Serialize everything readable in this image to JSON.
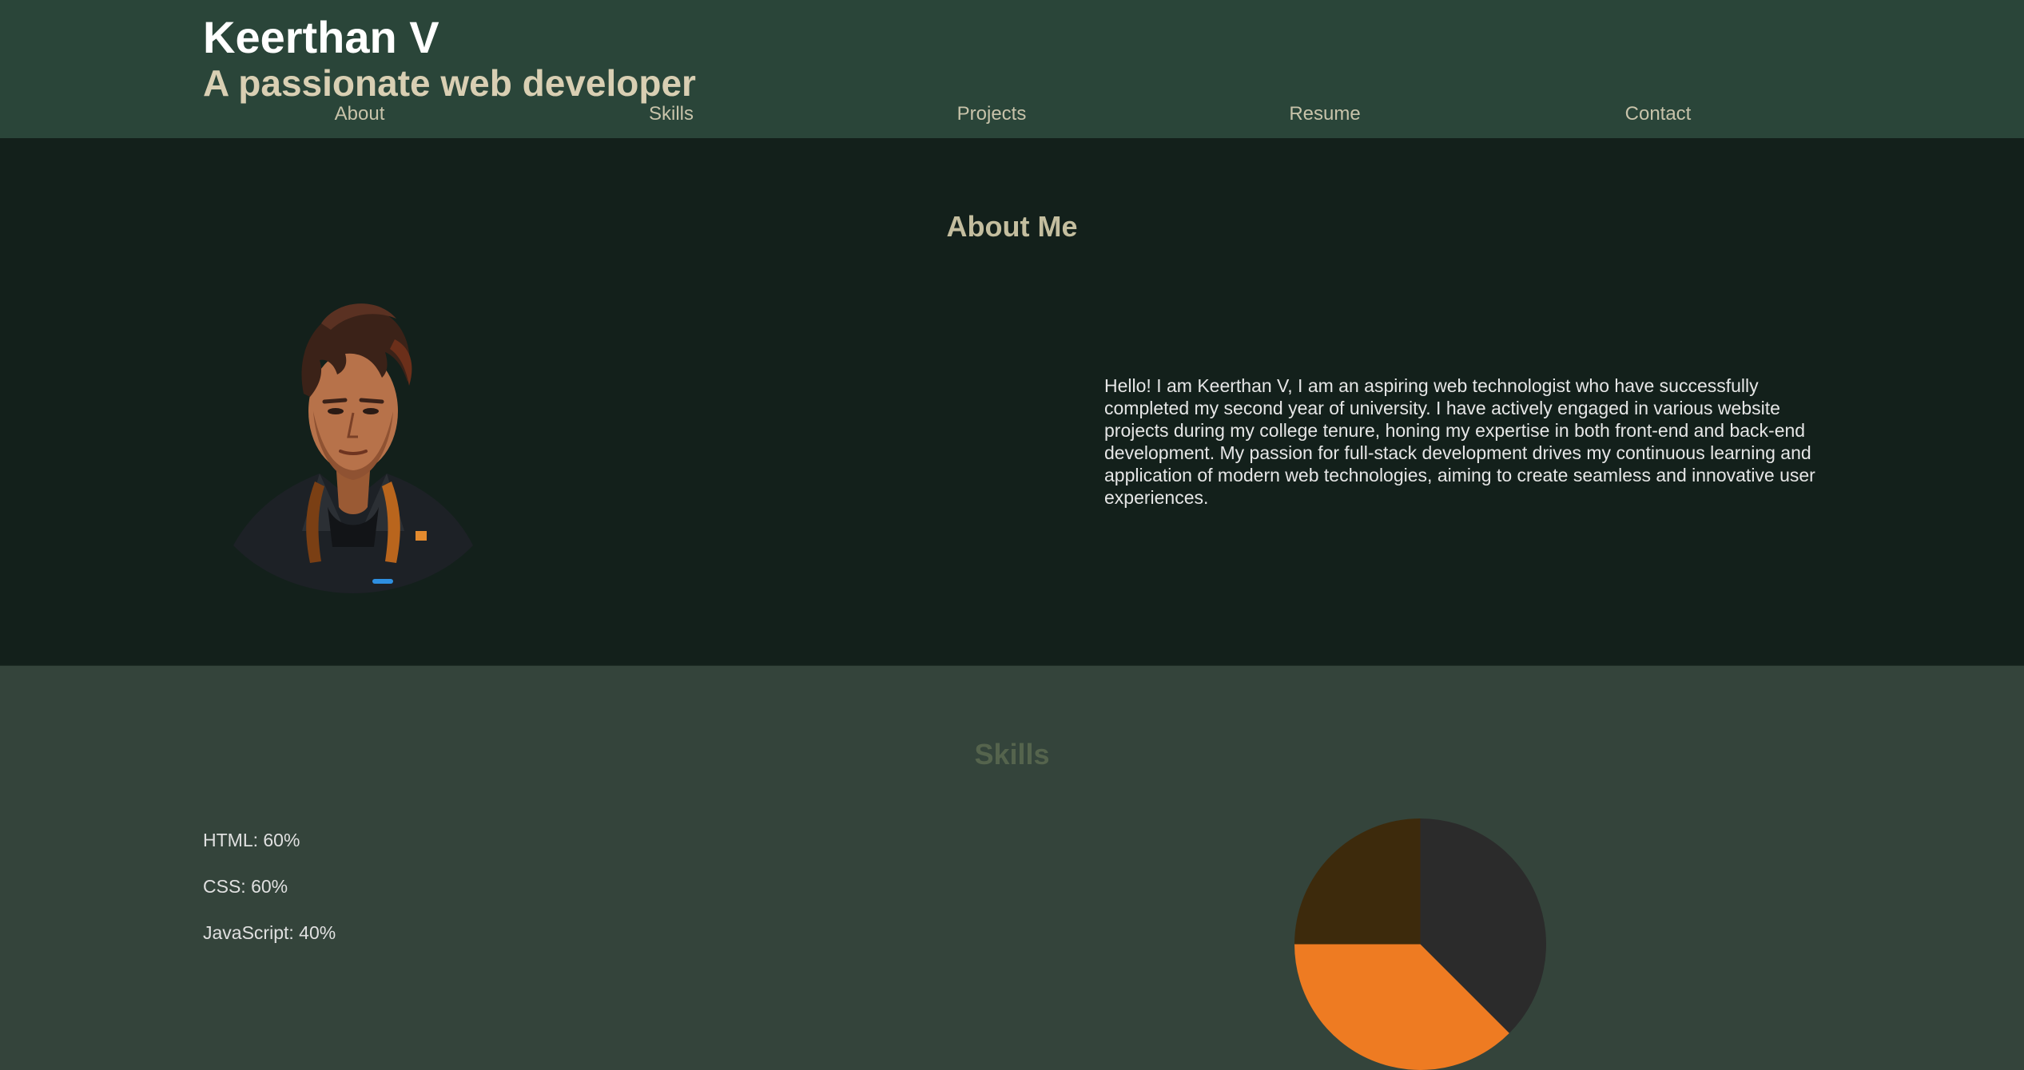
{
  "header": {
    "title": "Keerthan V",
    "subtitle": "A passionate web developer",
    "nav": [
      "About",
      "Skills",
      "Projects",
      "Resume",
      "Contact"
    ]
  },
  "about": {
    "heading": "About Me",
    "avatar_icon": "profile-portrait-image",
    "text": "Hello! I am Keerthan V, I am an aspiring web technologist who have successfully completed my second year of university. I have actively engaged in various website projects during my college tenure, honing my expertise in both front-end and back-end development. My passion for full-stack development drives my continuous learning and application of modern web technologies, aiming to create seamless and innovative user experiences."
  },
  "skills": {
    "heading": "Skills",
    "items": [
      {
        "label": "HTML:",
        "value": "60%"
      },
      {
        "label": "CSS:",
        "value": "60%"
      },
      {
        "label": "JavaScript:",
        "value": "40%"
      }
    ]
  },
  "chart_data": {
    "type": "pie",
    "categories": [
      "HTML",
      "CSS",
      "JavaScript"
    ],
    "values": [
      60,
      60,
      40
    ],
    "colors": [
      "#2b2b2b",
      "#ee7b22",
      "#3d2a0c",
      "#ffffff"
    ]
  },
  "colors": {
    "header_bg": "#2a4539",
    "about_bg": "#13201b",
    "skills_bg": "#34443b"
  }
}
